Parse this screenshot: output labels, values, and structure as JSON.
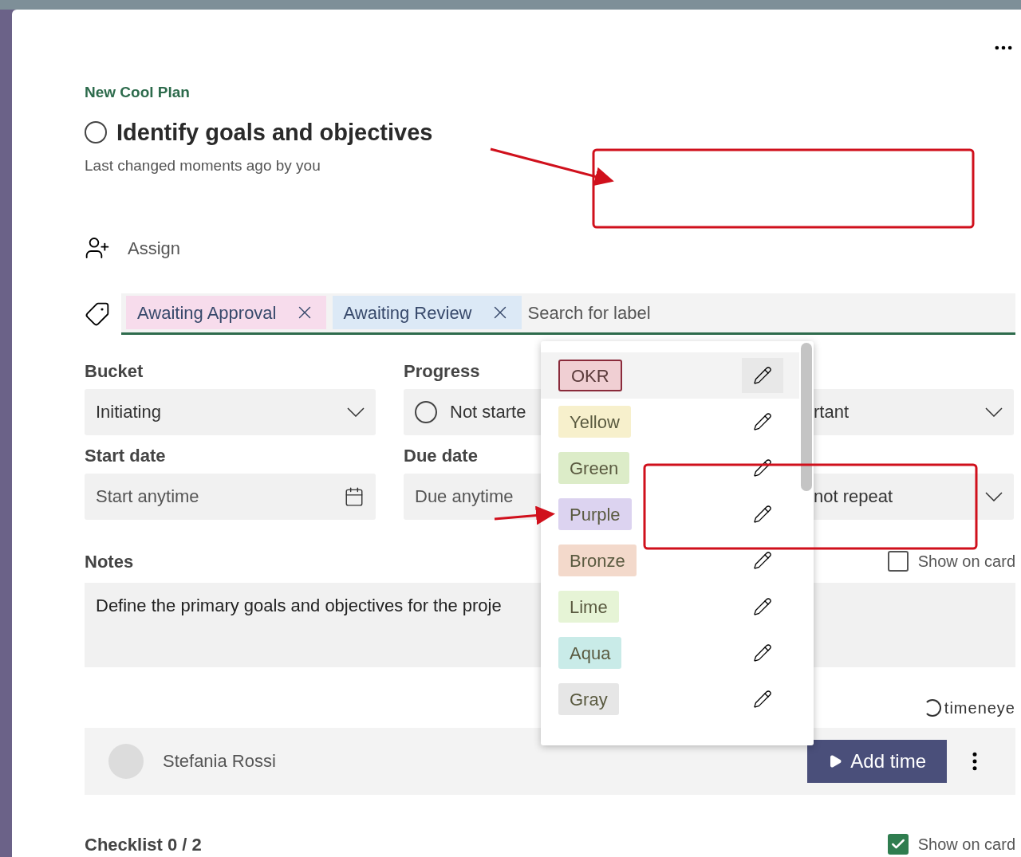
{
  "plan": "New Cool Plan",
  "task": {
    "title": "Identify goals and objectives",
    "completed": false,
    "meta": "Last changed moments ago by you"
  },
  "assign": {
    "label": "Assign"
  },
  "labels": {
    "chips": [
      {
        "text": "Awaiting Approval",
        "color": "#f7dcec"
      },
      {
        "text": "Awaiting Review",
        "color": "#dce9f6"
      }
    ],
    "placeholder": "Search for label"
  },
  "fields": [
    {
      "label": "Bucket",
      "value": "Initiating",
      "kind": "dropdown"
    },
    {
      "label": "Progress",
      "value": "Not starte",
      "kind": "progress"
    },
    {
      "value": "rtant",
      "kind": "dropdown"
    },
    {
      "label": "Start date",
      "value": "Start anytime",
      "kind": "date"
    },
    {
      "label": "Due date",
      "value": "Due anytime",
      "kind": "plain"
    },
    {
      "value": "not repeat",
      "kind": "dropdown"
    }
  ],
  "notes": {
    "label": "Notes",
    "show_on_card": false,
    "show_on_card_label": "Show on card",
    "text": "Define the primary goals and objectives for the proje"
  },
  "time_tracker": {
    "brand": "timeneye",
    "user": "Stefania Rossi",
    "button": "Add time"
  },
  "checklist": {
    "label": "Checklist 0 / 2",
    "show_on_card": true,
    "show_on_card_label": "Show on card"
  },
  "label_menu": [
    {
      "name": "OKR",
      "color": "#f0cfd3",
      "highlighted": true
    },
    {
      "name": "Yellow",
      "color": "#f7f0cc",
      "highlighted": false
    },
    {
      "name": "Green",
      "color": "#dcecc8",
      "highlighted": false
    },
    {
      "name": "Purple",
      "color": "#dcd3f0",
      "highlighted": false
    },
    {
      "name": "Bronze",
      "color": "#f3d9cb",
      "highlighted": false
    },
    {
      "name": "Lime",
      "color": "#e6f4d6",
      "highlighted": false
    },
    {
      "name": "Aqua",
      "color": "#c9ebe8",
      "highlighted": false
    },
    {
      "name": "Gray",
      "color": "#e6e6e6",
      "highlighted": false
    }
  ]
}
